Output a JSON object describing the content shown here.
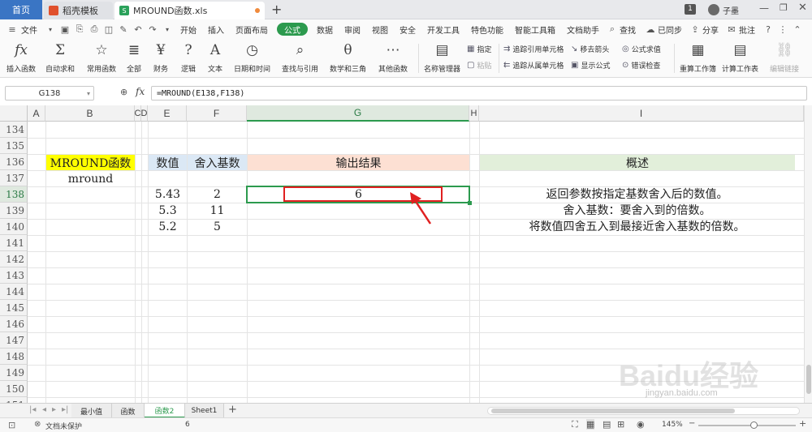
{
  "tabs": {
    "home": "首页",
    "daoke": "稻壳模板",
    "file": "MROUND函数.xls",
    "new": "+"
  },
  "window": {
    "badge": "1",
    "user": "子墨"
  },
  "menu": {
    "file": "文件",
    "items": [
      "开始",
      "插入",
      "页面布局",
      "公式",
      "数据",
      "审阅",
      "视图",
      "安全",
      "开发工具",
      "特色功能",
      "智能工具箱",
      "文档助手"
    ],
    "active_index": 3,
    "search": "查找",
    "sync": "已同步",
    "share": "分享",
    "comment": "批注"
  },
  "ribbon": {
    "insert_func": "插入函数",
    "autosum": "自动求和",
    "common": "常用函数",
    "all": "全部",
    "finance": "财务",
    "logic": "逻辑",
    "text": "文本",
    "datetime": "日期和时间",
    "lookup": "查找与引用",
    "math": "数学和三角",
    "other": "其他函数",
    "name_mgr": "名称管理器",
    "specify": "指定",
    "paste": "粘贴",
    "trace_prec": "追踪引用单元格",
    "trace_dep": "追踪从属单元格",
    "remove_arrows": "移去箭头",
    "show_formula": "显示公式",
    "eval_formula": "公式求值",
    "error_check": "错误检查",
    "recalc_book": "重算工作簿",
    "calc_sheet": "计算工作表",
    "edit_links": "编辑链接"
  },
  "formula_bar": {
    "name_box": "G138",
    "fx": "fx",
    "formula": "=MROUND(E138,F138)"
  },
  "columns": [
    "A",
    "B",
    "C",
    "D",
    "E",
    "F",
    "G",
    "H",
    "I"
  ],
  "rows": [
    "134",
    "135",
    "136",
    "137",
    "138",
    "139",
    "140",
    "141",
    "142",
    "143",
    "144",
    "145",
    "146",
    "147",
    "148",
    "149",
    "150",
    "151"
  ],
  "cells": {
    "b136": "MROUND函数",
    "b137": "mround",
    "e136": "数值",
    "f136": "舍入基数",
    "g136": "输出结果",
    "i136": "概述",
    "e138": "5.43",
    "f138": "2",
    "g138": "6",
    "e139": "5.3",
    "f139": "11",
    "e140": "5.2",
    "f140": "5",
    "i138": "返回参数按指定基数舍入后的数值。",
    "i139": "舍入基数：要舍入到的倍数。",
    "i140": "将数值四舍五入到最接近舍入基数的倍数。"
  },
  "sheets": [
    "最小值",
    "函数",
    "函数2",
    "Sheet1"
  ],
  "active_sheet_index": 2,
  "status": {
    "protect": "文档未保护",
    "value": "6",
    "zoom": "145%"
  },
  "watermark": {
    "brand": "Baidu经验",
    "url": "jingyan.baidu.com"
  },
  "colors": {
    "accent": "#2c9a4e",
    "yellow": "#ffff00",
    "blue_hdr": "#dbe8f5",
    "peach": "#fde0d3",
    "green_hdr": "#e2efda",
    "red": "#e02020"
  }
}
